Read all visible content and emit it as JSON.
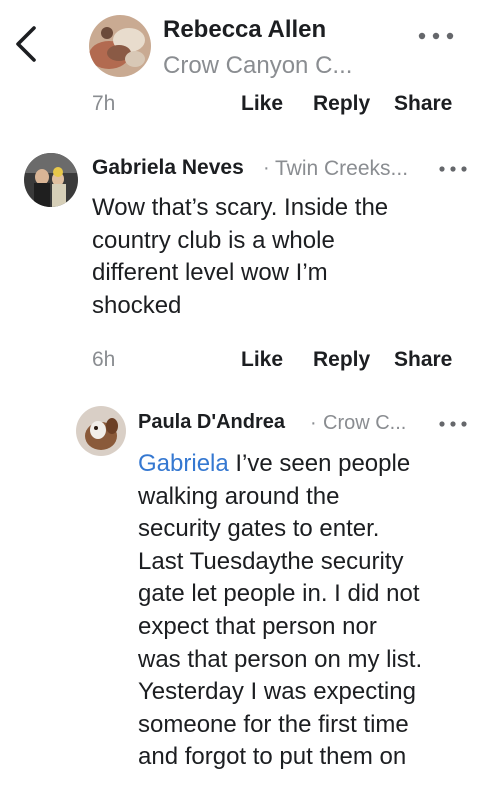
{
  "nav": {
    "back_icon": "chevron-left-icon"
  },
  "comments": [
    {
      "author": "Rebecca Allen",
      "location": "Crow Canyon C...",
      "time": "7h",
      "actions": {
        "like": "Like",
        "reply": "Reply",
        "share": "Share"
      },
      "more_icon": "more-horizontal-icon"
    },
    {
      "author": "Gabriela Neves",
      "separator": "·",
      "location": "Twin Creeks...",
      "text_lines": [
        "Wow that’s scary. Inside the",
        "country club is a whole",
        "different level wow I’m",
        "shocked"
      ],
      "time": "6h",
      "actions": {
        "like": "Like",
        "reply": "Reply",
        "share": "Share"
      },
      "more_icon": "more-horizontal-icon"
    },
    {
      "author": "Paula D'Andrea",
      "separator": "·",
      "location": "Crow C...",
      "mention": "Gabriela",
      "text_lines": [
        " I’ve seen people",
        "walking around the",
        "security gates to enter.",
        "Last Tuesdaythe security",
        "gate let people in. I did not",
        "expect that person nor",
        "was that person on my list.",
        "Yesterday I was expecting",
        "someone for the first time",
        "and forgot to put them on"
      ],
      "more_icon": "more-horizontal-icon"
    }
  ],
  "colors": {
    "text": "#1c1e21",
    "meta": "#8a8d91",
    "mention": "#3578d1",
    "background": "#ffffff"
  }
}
